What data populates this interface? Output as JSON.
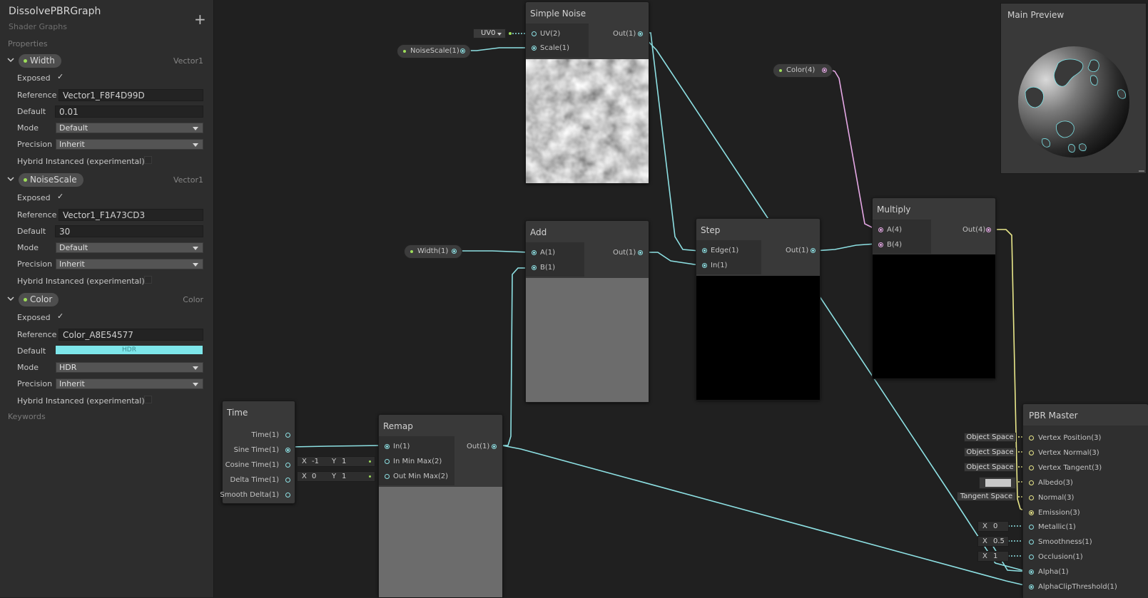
{
  "blackboard": {
    "title": "DissolvePBRGraph",
    "subtitle": "Shader Graphs",
    "properties_label": "Properties",
    "keywords_label": "Keywords",
    "labels": {
      "exposed": "Exposed",
      "reference": "Reference",
      "default": "Default",
      "mode": "Mode",
      "precision": "Precision",
      "hybrid": "Hybrid Instanced (experimental)"
    },
    "properties": [
      {
        "name": "Width",
        "type": "Vector1",
        "reference": "Vector1_F8F4D99D",
        "default": "0.01",
        "mode": "Default",
        "precision": "Inherit"
      },
      {
        "name": "NoiseScale",
        "type": "Vector1",
        "reference": "Vector1_F1A73CD3",
        "default": "30",
        "mode": "Default",
        "precision": "Inherit"
      },
      {
        "name": "Color",
        "type": "Color",
        "reference": "Color_A8E54577",
        "default": "HDR",
        "mode": "HDR",
        "precision": "Inherit"
      }
    ]
  },
  "nodes": {
    "simple_noise": {
      "title": "Simple Noise",
      "in1": "UV(2)",
      "in2": "Scale(1)",
      "out": "Out(1)",
      "uv_dropdown": "UV0"
    },
    "noise_scale_prop": {
      "label": "NoiseScale(1)"
    },
    "color_prop": {
      "label": "Color(4)"
    },
    "width_prop": {
      "label": "Width(1)"
    },
    "add": {
      "title": "Add",
      "in1": "A(1)",
      "in2": "B(1)",
      "out": "Out(1)"
    },
    "step": {
      "title": "Step",
      "in1": "Edge(1)",
      "in2": "In(1)",
      "out": "Out(1)"
    },
    "multiply": {
      "title": "Multiply",
      "in1": "A(4)",
      "in2": "B(4)",
      "out": "Out(4)"
    },
    "time": {
      "title": "Time",
      "outs": [
        "Time(1)",
        "Sine Time(1)",
        "Cosine Time(1)",
        "Delta Time(1)",
        "Smooth Delta(1)"
      ]
    },
    "remap": {
      "title": "Remap",
      "in1": "In(1)",
      "in2": "In Min Max(2)",
      "in3": "Out Min Max(2)",
      "out": "Out(1)",
      "in_min_max": {
        "x_label": "X",
        "x": "-1",
        "y_label": "Y",
        "y": "1"
      },
      "out_min_max": {
        "x_label": "X",
        "x": "0",
        "y_label": "Y",
        "y": "1"
      }
    },
    "pbr_master": {
      "title": "PBR Master",
      "inputs": [
        "Vertex Position(3)",
        "Vertex Normal(3)",
        "Vertex Tangent(3)",
        "Albedo(3)",
        "Normal(3)",
        "Emission(3)",
        "Metallic(1)",
        "Smoothness(1)",
        "Occlusion(1)",
        "Alpha(1)",
        "AlphaClipThreshold(1)"
      ],
      "space_chips": [
        "Object Space",
        "Object Space",
        "Object Space"
      ],
      "normal_chip": "Tangent Space",
      "x_label": "X",
      "metallic": "0",
      "smoothness": "0.5",
      "occlusion": "1"
    }
  },
  "main_preview": {
    "title": "Main Preview"
  },
  "colors": {
    "accent_cyan": "#7ee6ea",
    "wire": "#8de0e3",
    "wire_yellow": "#e9e78a",
    "wire_pink": "#e5a8e5"
  }
}
